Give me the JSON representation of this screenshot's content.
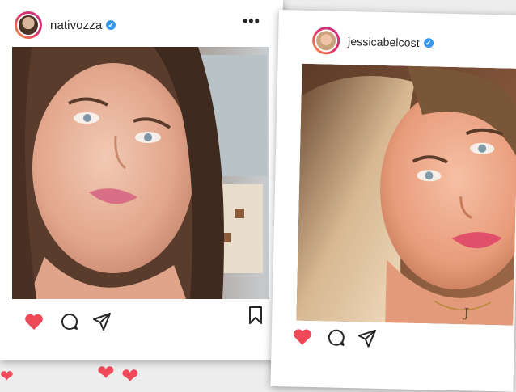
{
  "posts": [
    {
      "username": "nativozza",
      "verified": true,
      "more_label": "•••",
      "icons": [
        "heart-icon",
        "comment-icon",
        "share-icon",
        "bookmark-icon"
      ],
      "colors": {
        "like": "#ed4956",
        "verified": "#3897f0"
      }
    },
    {
      "username": "jessicabelcost",
      "verified": true,
      "icons": [
        "heart-icon",
        "comment-icon",
        "share-icon"
      ],
      "colors": {
        "like": "#ed4956",
        "verified": "#3897f0"
      }
    }
  ],
  "background": {
    "decoration": "heart-icon",
    "color": "#f04a5a"
  }
}
